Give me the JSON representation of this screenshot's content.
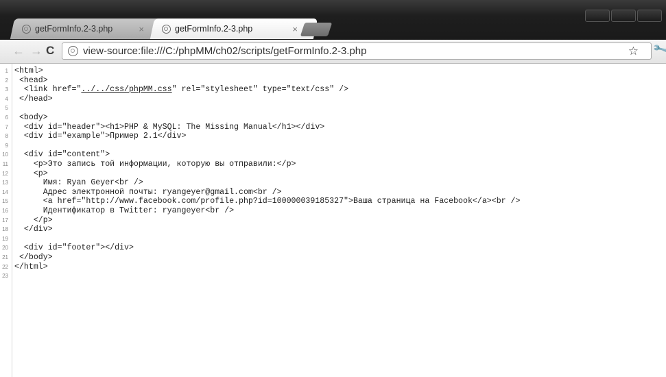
{
  "tabs": [
    {
      "title": "getFormInfo.2-3.php",
      "close": "×"
    },
    {
      "title": "getFormInfo.2-3.php",
      "close": "×"
    }
  ],
  "toolbar": {
    "back": "←",
    "forward": "→",
    "reload": "C",
    "url": "view-source:file:///C:/phpMM/ch02/scripts/getFormInfo.2-3.php",
    "star": "☆",
    "wrench": "🔧"
  },
  "source_lines": [
    {
      "n": "1",
      "code": "<html>"
    },
    {
      "n": "2",
      "code": " <head>"
    },
    {
      "n": "3",
      "code": "  <link href=\"",
      "link": "../../css/phpMM.css",
      "after": "\" rel=\"stylesheet\" type=\"text/css\" />"
    },
    {
      "n": "4",
      "code": " </head>"
    },
    {
      "n": "5",
      "code": ""
    },
    {
      "n": "6",
      "code": " <body>"
    },
    {
      "n": "7",
      "code": "  <div id=\"header\"><h1>PHP & MySQL: The Missing Manual</h1></div>"
    },
    {
      "n": "8",
      "code": "  <div id=\"example\">Пример 2.1</div>"
    },
    {
      "n": "9",
      "code": ""
    },
    {
      "n": "10",
      "code": "  <div id=\"content\">"
    },
    {
      "n": "11",
      "code": "    <p>Это запись той информации, которую вы отправили:</p>"
    },
    {
      "n": "12",
      "code": "    <p>"
    },
    {
      "n": "13",
      "code": "      Имя: Ryan Geyer<br />"
    },
    {
      "n": "14",
      "code": "      Адрес электронной почты: ryangeyer@gmail.com<br />"
    },
    {
      "n": "15",
      "code": "      <a href=\"http://www.facebook.com/profile.php?id=100000039185327\">Ваша страница на Facebook</a><br />"
    },
    {
      "n": "16",
      "code": "      Идентификатор в Twitter: ryangeyer<br />"
    },
    {
      "n": "17",
      "code": "    </p>"
    },
    {
      "n": "18",
      "code": "  </div>"
    },
    {
      "n": "19",
      "code": ""
    },
    {
      "n": "20",
      "code": "  <div id=\"footer\"></div>"
    },
    {
      "n": "21",
      "code": " </body>"
    },
    {
      "n": "22",
      "code": "</html>"
    },
    {
      "n": "23",
      "code": ""
    }
  ]
}
